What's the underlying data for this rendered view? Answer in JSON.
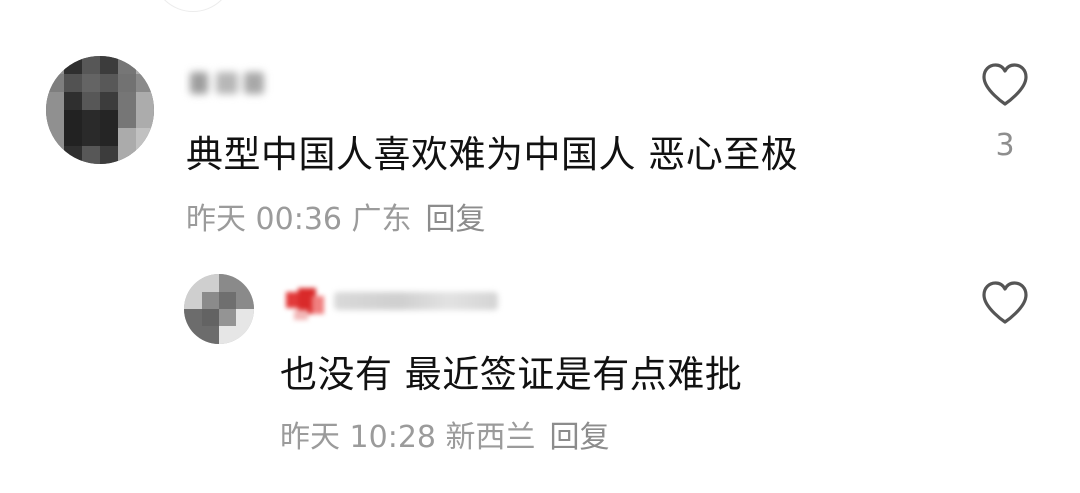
{
  "comments": [
    {
      "text": "典型中国人喜欢难为中国人 恶心至极",
      "meta": "昨天 00:36 广东",
      "reply_label": "回复",
      "like_count": "3"
    },
    {
      "text": "也没有 最近签证是有点难批",
      "meta": "昨天 10:28 新西兰",
      "reply_label": "回复",
      "like_count": ""
    }
  ],
  "colors": {
    "text": "#111111",
    "meta": "#9b9b9b",
    "icon": "#555555"
  }
}
